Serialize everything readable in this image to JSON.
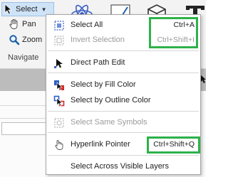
{
  "ribbon": {
    "select_label": "Select",
    "pan_label": "Pan",
    "zoom_label": "Zoom",
    "group_label": "Navigate"
  },
  "menu": {
    "items": [
      {
        "label": "Select All",
        "shortcut": "Ctrl+A",
        "enabled": true
      },
      {
        "label": "Invert Selection",
        "shortcut": "Ctrl+Shift+I",
        "enabled": false
      },
      {
        "label": "Direct Path Edit",
        "shortcut": "",
        "enabled": true
      },
      {
        "label": "Select by Fill Color",
        "shortcut": "",
        "enabled": true
      },
      {
        "label": "Select by Outline Color",
        "shortcut": "",
        "enabled": true
      },
      {
        "label": "Select Same Symbols",
        "shortcut": "",
        "enabled": false
      },
      {
        "label": "Hyperlink Pointer",
        "shortcut": "Ctrl+Shift+Q",
        "enabled": true
      },
      {
        "label": "Select Across Visible Layers",
        "shortcut": "",
        "enabled": true
      }
    ]
  },
  "colors": {
    "highlight": "#2db24a",
    "ribbon_bg": "#f3f3f3",
    "select_button_bg": "#cfe3f7"
  }
}
